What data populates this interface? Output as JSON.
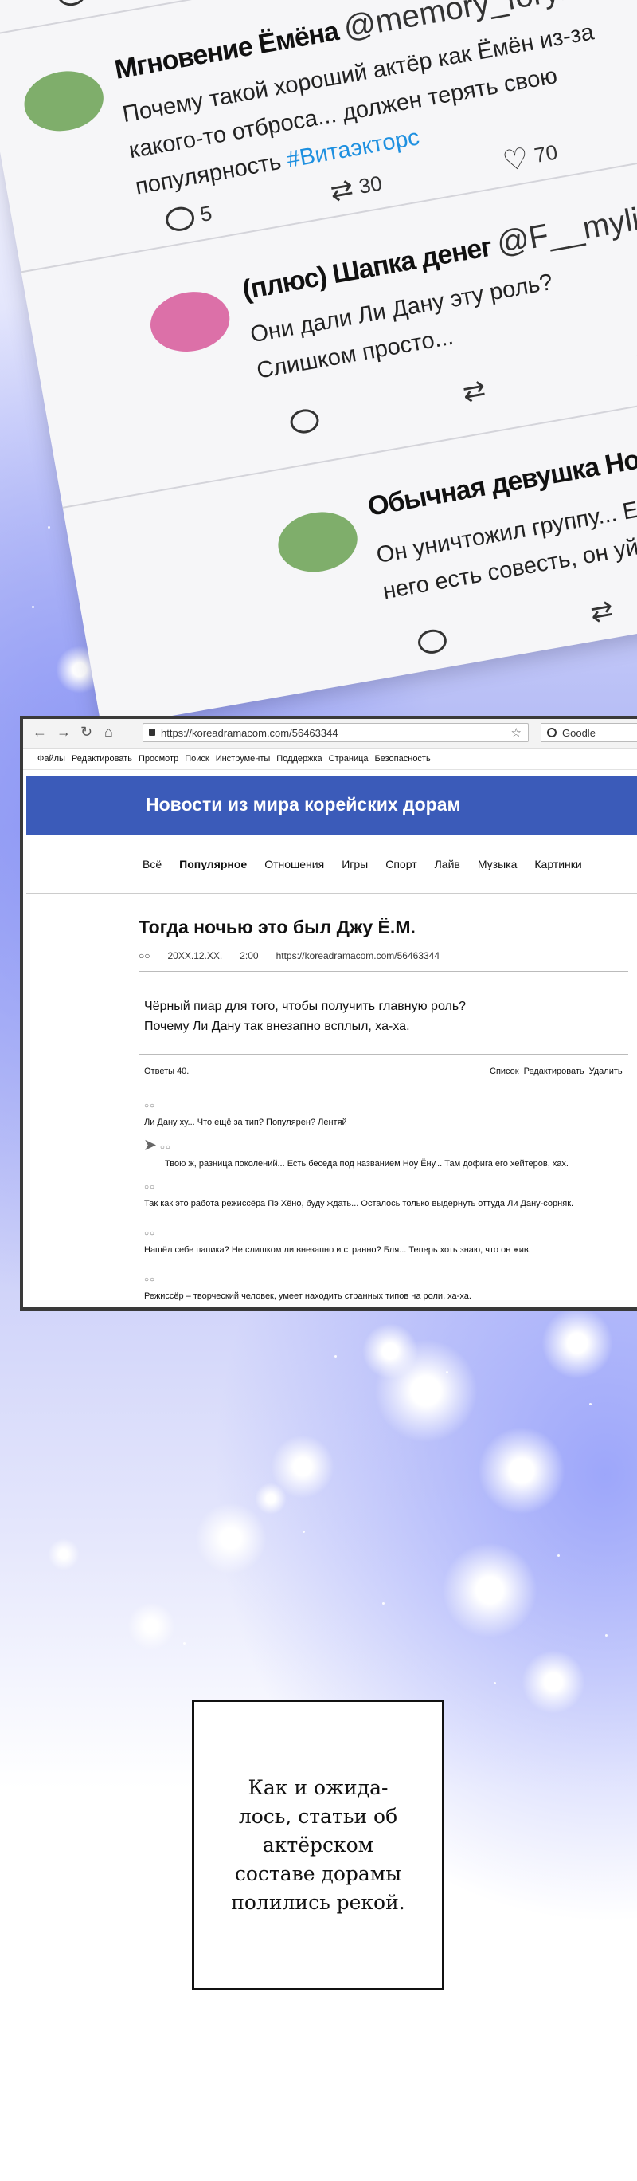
{
  "feed": {
    "top_count": "3",
    "tweets": [
      {
        "name": "Мгновение Ёмёна",
        "handle": "@memory_forym",
        "more": "·",
        "avatar_color": "#7fae6b",
        "line1": "Почему такой хороший актёр как Ёмён из-за",
        "line2": "какого-то отброса... должен терять свою",
        "line3": "популярность ",
        "hashtag": "#Витаэкторс",
        "comments": "5",
        "retweets": "30",
        "likes": "70"
      },
      {
        "name": "(плюс) Шапка денег",
        "handle": "@F__mylife",
        "avatar_color": "#dc70a8",
        "line1": "Они дали Ли Дану эту роль?",
        "line2": "Слишком просто..."
      },
      {
        "name": "Обычная девушка Ноу Ёну",
        "avatar_color": "#7fae6b",
        "line1": "Он уничтожил группу... Если у",
        "line2": "него есть совесть, он уйдёт"
      }
    ]
  },
  "browser": {
    "url": "https://koreadramacom.com/56463344",
    "search_engine": "Goodle",
    "menu": [
      "Файлы",
      "Редактировать",
      "Просмотр",
      "Поиск",
      "Инструменты",
      "Поддержка",
      "Страница",
      "Безопасность"
    ],
    "site_title": "Новости из мира корейских дорам",
    "categories": [
      "Всё",
      "Популярное",
      "Отношения",
      "Игры",
      "Спорт",
      "Лайв",
      "Музыка",
      "Картинки"
    ],
    "article": {
      "title": "Тогда ночью это был Джу Ё.М.",
      "author_mark": "○○",
      "date": "20XX.12.XX.",
      "time": "2:00",
      "url": "https://koreadramacom.com/56463344",
      "lead1": "Чёрный пиар для того, чтобы получить главную роль?",
      "lead2": "Почему Ли Дану так внезапно всплыл, ха-ха."
    },
    "replies_label": "Ответы 40.",
    "reply_actions": [
      "Список",
      "Редактировать",
      "Удалить"
    ],
    "comments": [
      {
        "user": "○○",
        "text": "Ли Дану ху... Что ещё за тип? Популярен? Лентяй"
      },
      {
        "user": "○○",
        "text": "Твою ж, разница поколений... Есть беседа под названием Ноу Ёну... Там дофига его хейтеров, хах."
      },
      {
        "user": "○○",
        "text": "Так как это работа режиссёра Пэ Хёно, буду ждать... Осталось только выдернуть оттуда Ли Дану-сорняк."
      },
      {
        "user": "○○",
        "text": "Нашёл себе папика? Не слишком ли внезапно и странно? Бля... Теперь хоть знаю, что он жив."
      },
      {
        "user": "○○",
        "text": "Режиссёр – творческий человек, умеет находить странных типов на роли, ха-ха."
      }
    ]
  },
  "caption": "Как и ожида-лось, статьи об актёрском составе дорамы полились рекой."
}
